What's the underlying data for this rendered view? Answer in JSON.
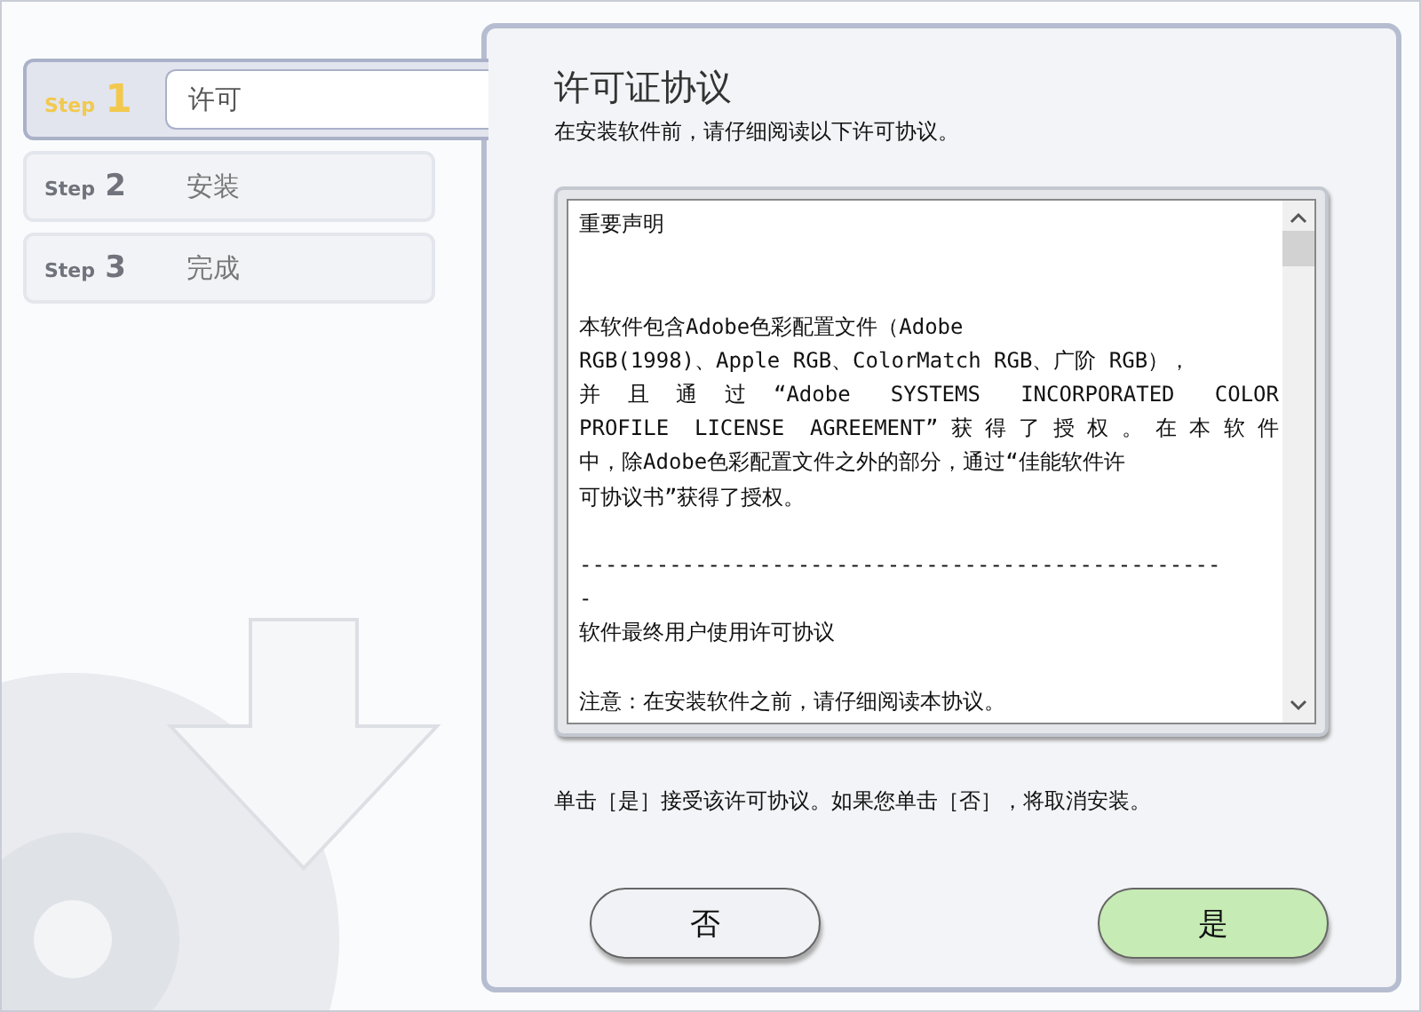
{
  "steps": [
    {
      "prefix": "Step",
      "number": "1",
      "label": "许可",
      "selected": true
    },
    {
      "prefix": "Step",
      "number": "2",
      "label": "安装",
      "selected": false
    },
    {
      "prefix": "Step",
      "number": "3",
      "label": "完成",
      "selected": false
    }
  ],
  "title": "许可证协议",
  "subtitle": "在安装软件前，请仔细阅读以下许可协议。",
  "license_lines": [
    {
      "kind": "plain",
      "text": "重要声明"
    },
    {
      "kind": "blank"
    },
    {
      "kind": "blank"
    },
    {
      "kind": "plain",
      "text": "本软件包含Adobe色彩配置文件（Adobe"
    },
    {
      "kind": "plain",
      "text": "RGB(1998)、Apple RGB、ColorMatch RGB、广阶 RGB），"
    },
    {
      "kind": "justified",
      "text": "并且通过“Adobe SYSTEMS INCORPORATED COLOR"
    },
    {
      "kind": "justified",
      "text": "PROFILE LICENSE AGREEMENT”获得了授权。在本软件"
    },
    {
      "kind": "plain",
      "text": "中，除Adobe色彩配置文件之外的部分，通过“佳能软件许"
    },
    {
      "kind": "plain",
      "text": "可协议书”获得了授权。"
    },
    {
      "kind": "blank"
    },
    {
      "kind": "plain",
      "text": "--------------------------------------------------"
    },
    {
      "kind": "plain",
      "text": "-"
    },
    {
      "kind": "plain",
      "text": "软件最终用户使用许可协议"
    },
    {
      "kind": "blank"
    },
    {
      "kind": "plain",
      "text": "注意：在安装软件之前，请仔细阅读本协议。"
    }
  ],
  "instruction": "单击［是］接受该许可协议。如果您单击［否］，将取消安装。",
  "buttons": [
    {
      "label": "否",
      "default": false
    },
    {
      "label": "是",
      "default": true
    }
  ]
}
